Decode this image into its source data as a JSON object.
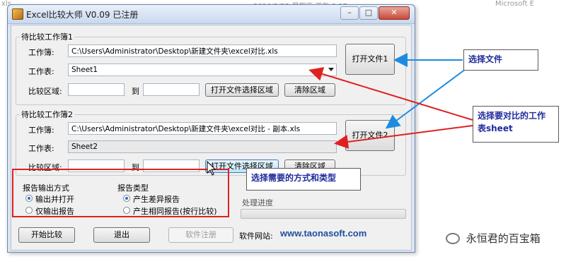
{
  "background_text": [
    "xls",
    "2010/2/22 星期五 下午 3:17",
    "Microsoft E"
  ],
  "window": {
    "title": "Excel比较大师 V0.09 已注册",
    "controls": {
      "minimize": "–",
      "maximize": "□",
      "close": "✕"
    }
  },
  "book1": {
    "group_label": "待比较工作簿1",
    "workbook_label": "工作簿:",
    "workbook_value": "C:\\Users\\Administrator\\Desktop\\新建文件夹\\excel对比.xls",
    "sheet_label": "工作表:",
    "sheet_value": "Sheet1",
    "open_button": "打开文件1",
    "range_label": "比较区域:",
    "to_label": "到",
    "range_from": "",
    "range_to": "",
    "select_range_button": "打开文件选择区域",
    "clear_range_button": "清除区域"
  },
  "book2": {
    "group_label": "待比较工作簿2",
    "workbook_label": "工作簿:",
    "workbook_value": "C:\\Users\\Administrator\\Desktop\\新建文件夹\\excel对比 - 副本.xls",
    "sheet_label": "工作表:",
    "sheet_value": "Sheet2",
    "open_button": "打开文件2",
    "range_label": "比较区域:",
    "to_label": "到",
    "range_from": "",
    "range_to": "",
    "select_range_button": "打开文件选择区域",
    "clear_range_button": "清除区域"
  },
  "report_output": {
    "label": "报告输出方式",
    "options": [
      {
        "label": "输出并打开",
        "selected": true
      },
      {
        "label": "仅输出报告",
        "selected": false
      }
    ]
  },
  "report_type": {
    "label": "报告类型",
    "options": [
      {
        "label": "产生差异报告",
        "selected": true
      },
      {
        "label": "产生相同报告(按行比较)",
        "selected": false
      }
    ]
  },
  "progress": {
    "label": "处理进度",
    "value": 0
  },
  "actions": {
    "start": "开始比较",
    "exit": "退出",
    "register": "软件注册",
    "website_label": "软件网站:",
    "website_url": "www.taonasoft.com"
  },
  "annotations": {
    "select_file": "选择文件",
    "select_sheet_line1": "选择要对比的工作",
    "select_sheet_line2": "表sheet",
    "select_mode": "选择需要的方式和类型",
    "arrow_colors": {
      "blue": "#1e8be0",
      "red": "#e02020"
    }
  },
  "footer": {
    "text": "永恒君的百宝箱"
  }
}
